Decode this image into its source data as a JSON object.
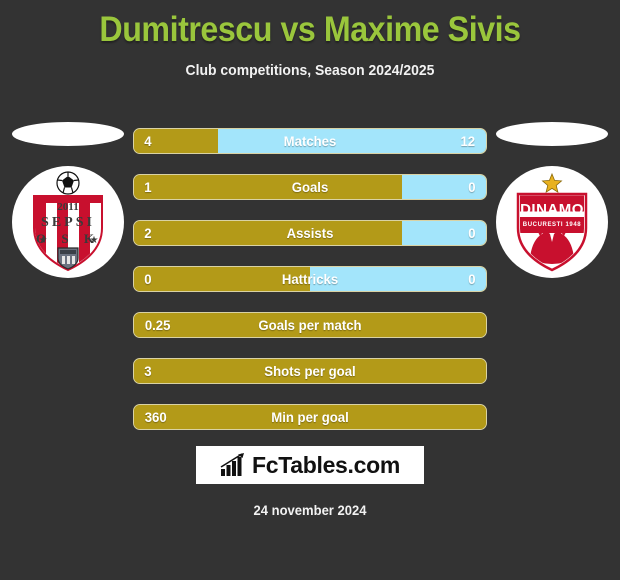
{
  "header": {
    "title": "Dumitrescu vs Maxime Sivis",
    "subtitle": "Club competitions, Season 2024/2025",
    "title_color": "#9ac63c"
  },
  "colors": {
    "background": "#333333",
    "home_bar": "#b39a18",
    "away_bar": "#a3e5fb",
    "bar_border": "#d9d2a4",
    "text": "#ffffff"
  },
  "logos": {
    "home": {
      "name": "sepsi-osk-crest",
      "founded": "2011",
      "line1": "SEPSI",
      "line2": "O S K"
    },
    "away": {
      "name": "dinamo-bucuresti-crest",
      "line1": "DINAMO"
    }
  },
  "stats": [
    {
      "label": "Matches",
      "home": "4",
      "away": "12",
      "home_pct": 24,
      "split": true
    },
    {
      "label": "Goals",
      "home": "1",
      "away": "0",
      "home_pct": 76,
      "split": true
    },
    {
      "label": "Assists",
      "home": "2",
      "away": "0",
      "home_pct": 76,
      "split": true
    },
    {
      "label": "Hattricks",
      "home": "0",
      "away": "0",
      "home_pct": 50,
      "split": true
    },
    {
      "label": "Goals per match",
      "home": "0.25",
      "away": "",
      "home_pct": 100,
      "split": false
    },
    {
      "label": "Shots per goal",
      "home": "3",
      "away": "",
      "home_pct": 100,
      "split": false
    },
    {
      "label": "Min per goal",
      "home": "360",
      "away": "",
      "home_pct": 100,
      "split": false
    }
  ],
  "footer": {
    "brand": "FcTables.com",
    "date": "24 november 2024"
  }
}
